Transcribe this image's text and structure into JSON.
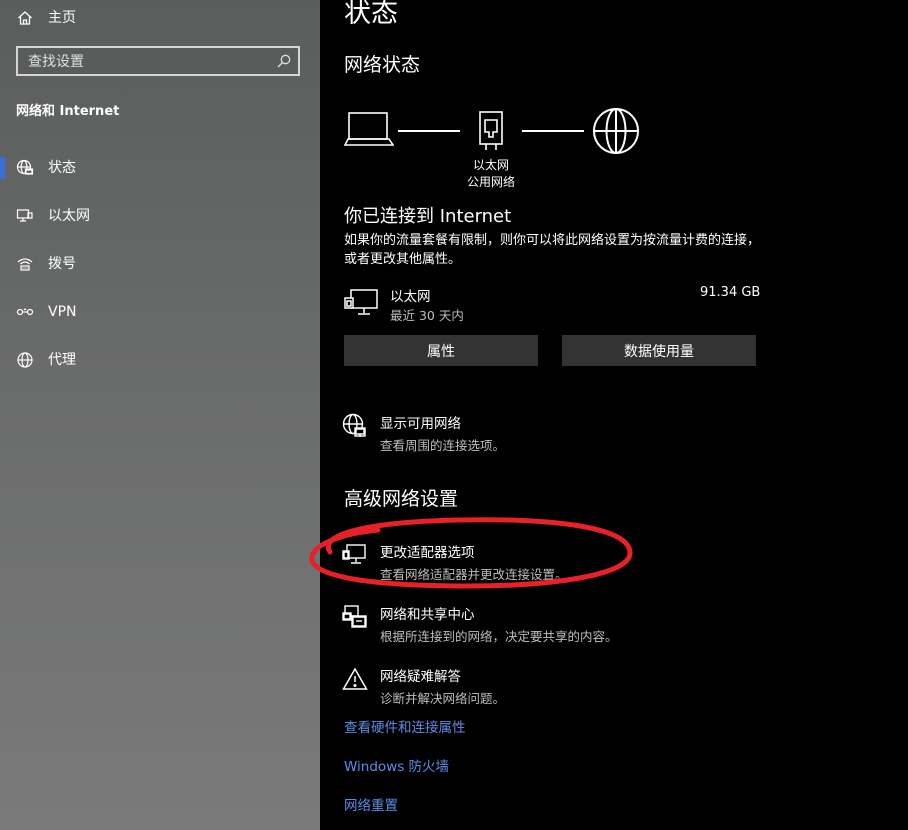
{
  "sidebar": {
    "home_label": "主页",
    "search_placeholder": "查找设置",
    "section_title": "网络和 Internet",
    "items": [
      {
        "label": "状态",
        "icon": "globe-status-icon"
      },
      {
        "label": "以太网",
        "icon": "ethernet-icon"
      },
      {
        "label": "拨号",
        "icon": "dialup-icon"
      },
      {
        "label": "VPN",
        "icon": "vpn-icon"
      },
      {
        "label": "代理",
        "icon": "globe-icon"
      }
    ],
    "selected_index": 0
  },
  "main": {
    "page_title": "状态",
    "network_status_heading": "网络状态",
    "diagram": {
      "label_line1": "以太网",
      "label_line2": "公用网络"
    },
    "connected_heading": "你已连接到 Internet",
    "connected_desc": "如果你的流量套餐有限制，则你可以将此网络设置为按流量计费的连接，或者更改其他属性。",
    "connection": {
      "name": "以太网",
      "sub": "最近 30 天内",
      "usage": "91.34 GB"
    },
    "buttons": {
      "properties": "属性",
      "data_usage": "数据使用量"
    },
    "show_networks": {
      "title": "显示可用网络",
      "sub": "查看周围的连接选项。"
    },
    "advanced_heading": "高级网络设置",
    "adapter_options": {
      "title": "更改适配器选项",
      "sub": "查看网络适配器并更改连接设置。"
    },
    "sharing_center": {
      "title": "网络和共享中心",
      "sub": "根据所连接到的网络，决定要共享的内容。"
    },
    "troubleshoot": {
      "title": "网络疑难解答",
      "sub": "诊断并解决网络问题。"
    },
    "links": {
      "hardware": "查看硬件和连接属性",
      "firewall": "Windows 防火墙",
      "reset": "网络重置"
    }
  },
  "colors": {
    "accent_blue": "#3a6fd8",
    "link_blue": "#5c8de6",
    "annotation_red": "#e8202a",
    "button_bg": "#333333"
  }
}
